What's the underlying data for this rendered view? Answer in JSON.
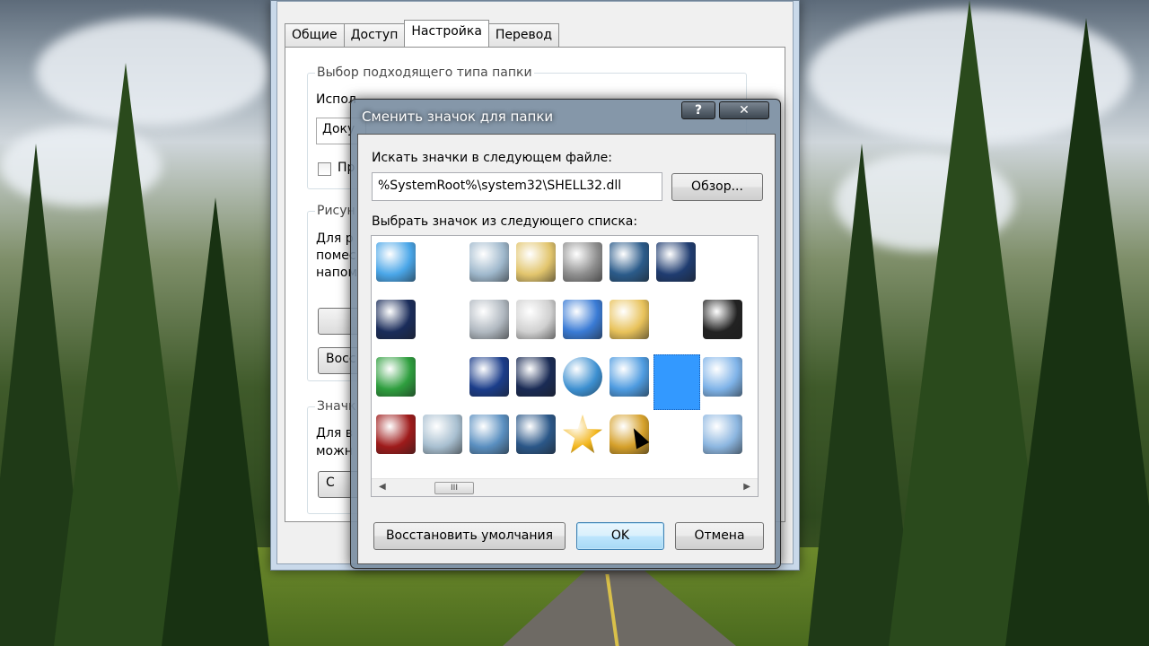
{
  "properties_window": {
    "tabs": [
      {
        "label": "Общие",
        "active": false
      },
      {
        "label": "Доступ",
        "active": false
      },
      {
        "label": "Настройка",
        "active": true
      },
      {
        "label": "Перевод",
        "active": false
      }
    ],
    "group_folder_type": {
      "title": "Выбор подходящего типа папки",
      "text_partial": "Испол",
      "combo_partial": "Доку",
      "checkbox_partial": "Пр"
    },
    "group_pictures": {
      "title_partial": "Рисун",
      "lines_partial": [
        "Для р",
        "помес",
        "напом"
      ],
      "button_partial": "Восс"
    },
    "group_icons": {
      "title_partial": "Значк",
      "lines_partial": [
        "Для в",
        "можн"
      ],
      "button_partial": "С"
    }
  },
  "dialog": {
    "title": "Сменить значок для папки",
    "help_label": "?",
    "close_label": "✕",
    "search_label": "Искать значки в следующем файле:",
    "path_value": "%SystemRoot%\\system32\\SHELL32.dll",
    "browse_label": "Обзор...",
    "list_label": "Выбрать значок из следующего списка:",
    "scrollbar_thumb": "III",
    "restore_label": "Восстановить умолчания",
    "ok_label": "OK",
    "cancel_label": "Отмена",
    "icons": [
      {
        "name": "display-settings-icon",
        "color": "#4aa6e8",
        "row": 0,
        "col": 0
      },
      {
        "name": "recycle-bin-icon",
        "color": "#9fb8cc",
        "row": 0,
        "col": 2
      },
      {
        "name": "calculator-folder-icon",
        "color": "#e2c56d",
        "row": 0,
        "col": 3
      },
      {
        "name": "cd-drive-icon",
        "color": "#8f8f8f",
        "row": 0,
        "col": 4
      },
      {
        "name": "lock-screen-icon",
        "color": "#2b5b8a",
        "row": 0,
        "col": 5
      },
      {
        "name": "monitor-icon",
        "color": "#1f3c70",
        "row": 0,
        "col": 6
      },
      {
        "name": "desktop-shortcut-icon",
        "color": "#1a2c5a",
        "row": 1,
        "col": 0
      },
      {
        "name": "scanner-icon",
        "color": "#b0b8c0",
        "row": 1,
        "col": 2
      },
      {
        "name": "printer-icon",
        "color": "#d0d0d0",
        "row": 1,
        "col": 3
      },
      {
        "name": "windows-box-icon",
        "color": "#3a7bd5",
        "row": 1,
        "col": 4
      },
      {
        "name": "search-folder-icon",
        "color": "#e8c25a",
        "row": 1,
        "col": 5
      },
      {
        "name": "unknown-drive-icon",
        "color": "#222222",
        "row": 1,
        "col": 7
      },
      {
        "name": "network-drive-icon",
        "color": "#2e9e3e",
        "row": 2,
        "col": 0
      },
      {
        "name": "tablet-icon",
        "color": "#1b3d8a",
        "row": 2,
        "col": 2
      },
      {
        "name": "font-icon",
        "color": "#1a2b55",
        "row": 2,
        "col": 3
      },
      {
        "name": "globe-network-icon",
        "color": "#3c8fd0",
        "row": 2,
        "col": 4
      },
      {
        "name": "internet-explorer-icon",
        "color": "#4e9be0",
        "row": 2,
        "col": 5
      },
      {
        "name": "blank-selected-icon",
        "color": "#3399ff",
        "row": 2,
        "col": 6
      },
      {
        "name": "stacked-blue-icon",
        "color": "#7fb3e8",
        "row": 2,
        "col": 7
      },
      {
        "name": "power-button-icon",
        "color": "#9e1b1b",
        "row": 3,
        "col": 0
      },
      {
        "name": "recycle-bin-full-icon",
        "color": "#a8bfd0",
        "row": 3,
        "col": 1
      },
      {
        "name": "tools-icon",
        "color": "#5a8fc0",
        "row": 3,
        "col": 2
      },
      {
        "name": "server-document-icon",
        "color": "#2b5788",
        "row": 3,
        "col": 3
      },
      {
        "name": "star-icon",
        "color": "#f2b51b",
        "row": 3,
        "col": 4
      },
      {
        "name": "padlock-icon",
        "color": "#d5a02a",
        "row": 3,
        "col": 5
      },
      {
        "name": "magnifier-doc-icon",
        "color": "#8cb6e0",
        "row": 3,
        "col": 7
      }
    ]
  }
}
